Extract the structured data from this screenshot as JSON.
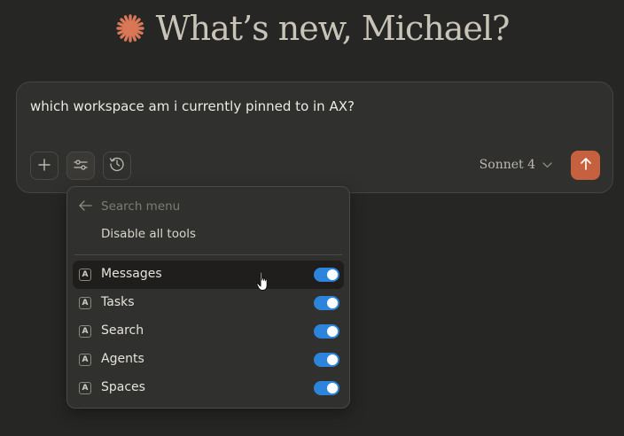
{
  "greeting": {
    "text": "What’s new, Michael?",
    "icon": "sparkle-logo-icon",
    "accent": "#d97757"
  },
  "composer": {
    "prompt": "which workspace am i currently pinned to in AX?",
    "buttons": [
      {
        "icon": "plus-icon"
      },
      {
        "icon": "sliders-icon"
      },
      {
        "icon": "history-clock-icon"
      }
    ],
    "model": "Sonnet 4",
    "send_icon": "arrow-up-icon",
    "send_color": "#c6613f"
  },
  "menu": {
    "search_placeholder": "Search menu",
    "disable_all": "Disable all tools",
    "badge_letter": "A",
    "tools": [
      {
        "label": "Messages",
        "enabled": true,
        "hovered": true
      },
      {
        "label": "Tasks",
        "enabled": true
      },
      {
        "label": "Search",
        "enabled": true
      },
      {
        "label": "Agents",
        "enabled": true
      },
      {
        "label": "Spaces",
        "enabled": true
      }
    ],
    "toggle_color": "#2c84db"
  }
}
